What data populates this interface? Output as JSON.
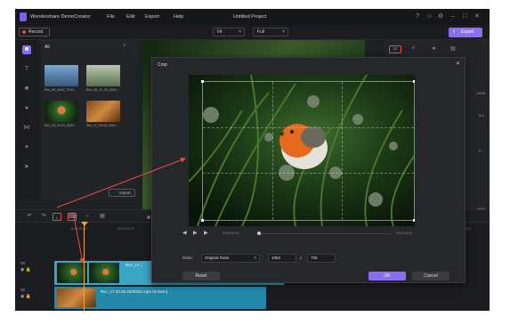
{
  "app": {
    "name": "Wondershare DemoCreator",
    "project_title": "Untitled Project",
    "menu": [
      "File",
      "Edit",
      "Export",
      "Help"
    ]
  },
  "toolbar": {
    "record_label": "Record",
    "fit_label": "Fit",
    "full_label": "Full",
    "export_label": "Export"
  },
  "media": {
    "filter_label": "All",
    "thumb_labels": [
      "Rec_06_46.67_2020...",
      "Rec_06_01_20_2020...",
      "Rec_10_20.03_2020...",
      "Rec_17_33.03_2020..."
    ],
    "import_label": "Import"
  },
  "timeline": {
    "ruler": [
      "00:00:00:00",
      "00:00:01:00",
      "00:00:0"
    ],
    "clip1_label": "Rec_17...",
    "clip2_label": "Rec_17.33.05 2020102.mp4 (Screen)",
    "track_numbers": [
      "03",
      "02"
    ]
  },
  "crop": {
    "title": "Crop",
    "time_start": "00:00:00:00",
    "time_end": "00:00:04:01",
    "ratio_label": "Ratio:",
    "ratio_value": "Original Ratio",
    "width": "1062",
    "times_sign": "x",
    "height": "705",
    "reset_label": "Reset",
    "ok_label": "OK",
    "cancel_label": "Cancel"
  },
  "right_panel": {
    "values": [
      "100%",
      "0.0",
      "0",
      "100%"
    ]
  },
  "colors": {
    "accent": "#8a6ef2",
    "annotation": "#e34b4b",
    "playhead": "#f2a23a",
    "clip_primary": "#3aa5c4",
    "clip_secondary": "#2389a8"
  }
}
